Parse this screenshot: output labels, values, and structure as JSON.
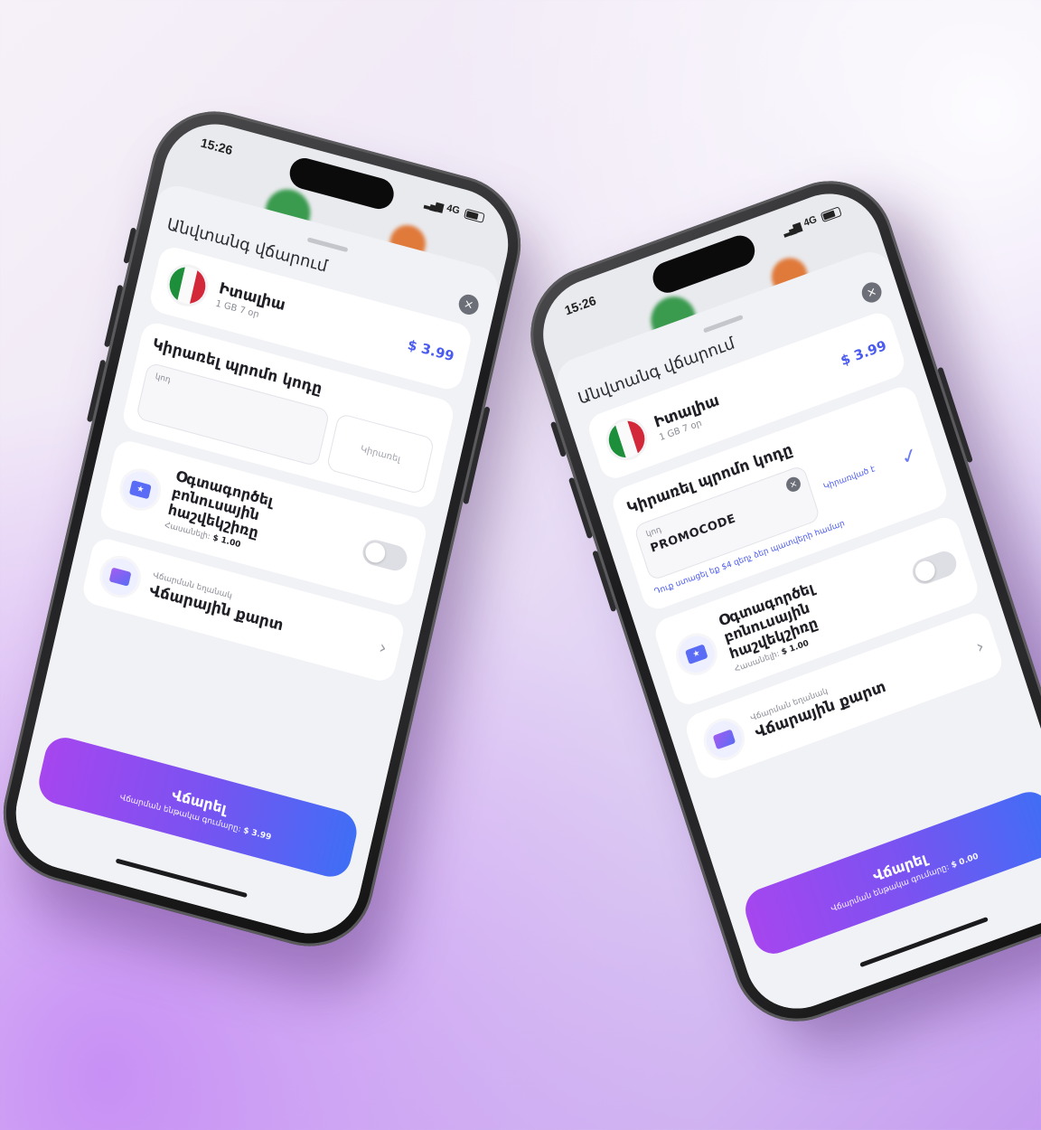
{
  "phones": [
    {
      "status": {
        "time": "15:26",
        "network": "4G"
      },
      "sheet": {
        "title": "Անվտանգ վճարում"
      },
      "plan": {
        "country": "Իտալիա",
        "details": "1 GB 7 օր",
        "price": "$ 3.99"
      },
      "promo": {
        "title": "Կիրառել պրոմո կոդը",
        "input_label": "կոդ",
        "input_value": "",
        "apply_label": "Կիրառել"
      },
      "bonus": {
        "title": "Օգտագործել բոնուսային հաշվեկշիռը",
        "balance_label": "Հասանելի:",
        "balance_value": "$ 1.00",
        "enabled": false
      },
      "payment": {
        "label": "Վճարման եղանակ",
        "method": "Վճարային քարտ"
      },
      "pay_button": {
        "title": "Վճարել",
        "subtitle": "Վճարման ենթակա գումարը:",
        "amount": "$ 3.99"
      }
    },
    {
      "status": {
        "time": "15:26",
        "network": "4G"
      },
      "sheet": {
        "title": "Անվտանգ վճարում"
      },
      "plan": {
        "country": "Իտալիա",
        "details": "1 GB 7 օր",
        "price": "$ 3.99"
      },
      "promo": {
        "title": "Կիրառել պրոմո կոդը",
        "input_label": "կոդ",
        "input_value": "PROMOCODE",
        "applied_label": "Կիրառված է",
        "note": "Դուք ստացել եք $4 զեղչ ձեր պատվերի համար"
      },
      "bonus": {
        "title": "Օգտագործել բոնուսային հաշվեկշիռը",
        "balance_label": "Հասանելի:",
        "balance_value": "$ 1.00",
        "enabled": false
      },
      "payment": {
        "label": "Վճարման եղանակ",
        "method": "Վճարային քարտ"
      },
      "pay_button": {
        "title": "Վճարել",
        "subtitle": "Վճարման ենթակա գումարը:",
        "amount": "$ 0.00"
      }
    }
  ],
  "icons": {
    "close": "×",
    "chevron": "›",
    "check": "✓",
    "bonus": "★"
  },
  "colors": {
    "accent": "#4b5bf0",
    "gradient_start": "#a646ef",
    "gradient_end": "#3f6ef5"
  }
}
